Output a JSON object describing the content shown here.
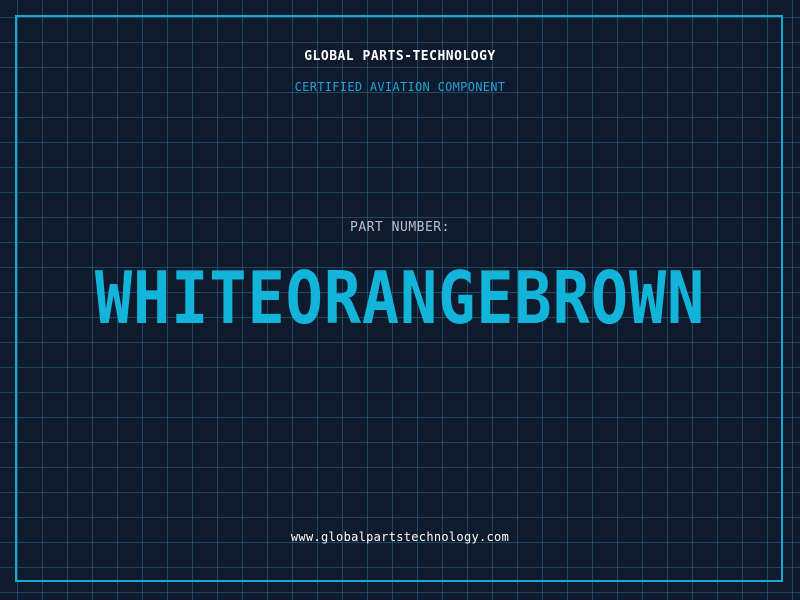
{
  "header": {
    "company": "GLOBAL PARTS-TECHNOLOGY",
    "subtitle": "CERTIFIED AVIATION COMPONENT"
  },
  "part": {
    "label": "PART NUMBER:",
    "number": "WHITEORANGEBROWN"
  },
  "footer": {
    "url": "www.globalpartstechnology.com"
  },
  "colors": {
    "background": "#101a2d",
    "grid": "#286e8c",
    "accent": "#12b4da",
    "frame": "#19a6d2"
  }
}
